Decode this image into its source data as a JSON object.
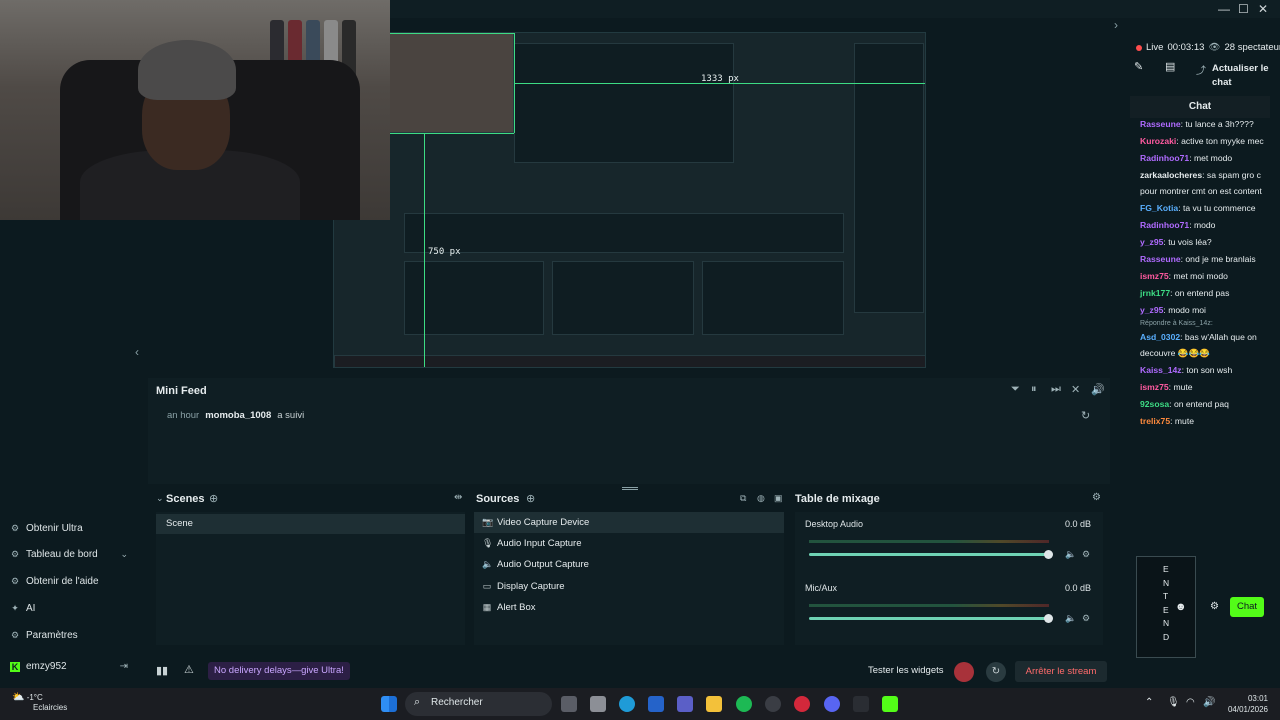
{
  "window_controls": {
    "minimize": "—",
    "maximize": "☐",
    "close": "✕"
  },
  "stream": {
    "status": "Live",
    "duration": "00:03:13",
    "viewers": "28 spectateurs",
    "refresh_chat": "Actualiser le chat"
  },
  "preview": {
    "width_label": "1333 px",
    "height_label": "750 px"
  },
  "left_nav": {
    "items": [
      {
        "label": "Obtenir Ultra",
        "icon": "ultra-icon"
      },
      {
        "label": "Tableau de bord",
        "icon": "dashboard-icon"
      },
      {
        "label": "Obtenir de l'aide",
        "icon": "help-icon"
      },
      {
        "label": "AI",
        "icon": "ai-icon"
      },
      {
        "label": "Paramètres",
        "icon": "settings-icon"
      }
    ],
    "user": "emzy952"
  },
  "mini_feed": {
    "title": "Mini Feed",
    "event": {
      "time": "an hour",
      "user": "momoba_1008",
      "action": "a suivi"
    }
  },
  "scenes": {
    "title": "Scenes",
    "items": [
      "Scene"
    ]
  },
  "sources": {
    "title": "Sources",
    "items": [
      {
        "label": "Video Capture Device",
        "icon": "camera-icon"
      },
      {
        "label": "Audio Input Capture",
        "icon": "microphone-icon"
      },
      {
        "label": "Audio Output Capture",
        "icon": "speaker-icon"
      },
      {
        "label": "Display Capture",
        "icon": "monitor-icon"
      },
      {
        "label": "Alert Box",
        "icon": "bell-icon"
      }
    ]
  },
  "mixer": {
    "title": "Table de mixage",
    "channels": [
      {
        "name": "Desktop Audio",
        "db": "0.0 dB",
        "level": 1.0
      },
      {
        "name": "Mic/Aux",
        "db": "0.0 dB",
        "level": 1.0
      }
    ]
  },
  "footer": {
    "ultra_banner": "No delivery delays—give Ultra!",
    "test_widgets": "Tester les widgets",
    "stop_stream": "Arrêter le stream"
  },
  "chat": {
    "title": "Chat",
    "send_label": "Chat",
    "input_text": "ENTEND",
    "messages": [
      {
        "user": "Rasseune",
        "text": "tu lance a 3h????",
        "color": "#b06bff"
      },
      {
        "user": "Kurozaki",
        "text": "active ton myyke mec",
        "color": "#ff5aa0"
      },
      {
        "user": "Radinhoo71",
        "text": "met modo",
        "color": "#b06bff"
      },
      {
        "user": "zarkaalocheres",
        "text": "sa spam gro c pour montrer cmt on est content",
        "color": "#e6ecee"
      },
      {
        "user": "FG_Kotia",
        "text": "ta vu tu commence",
        "color": "#5ab0ff"
      },
      {
        "user": "Radinhoo71",
        "text": "modo",
        "color": "#b06bff"
      },
      {
        "user": "y_z95",
        "text": "tu vois léa?",
        "color": "#b06bff"
      },
      {
        "user": "Rasseune",
        "text": "ond je me branlais",
        "color": "#b06bff"
      },
      {
        "user": "ismz75",
        "text": "met moi modo",
        "color": "#ff5aa0"
      },
      {
        "user": "jrnk177",
        "text": "on entend pas",
        "color": "#3ddc84"
      },
      {
        "user": "y_z95",
        "text": "modo moi",
        "color": "#b06bff"
      },
      {
        "reply": "Répondre à Kaiss_14z:",
        "user": "Asd_0302",
        "text": "bas w'Allah que on decouvre 😂😂😂",
        "color": "#5ab0ff"
      },
      {
        "user": "Kaiss_14z",
        "text": "ton son wsh",
        "color": "#b06bff"
      },
      {
        "user": "ismz75",
        "text": "mute",
        "color": "#ff5aa0"
      },
      {
        "user": "92sosa",
        "text": "on entend paq",
        "color": "#3ddc84"
      },
      {
        "user": "trelix75",
        "text": "mute",
        "color": "#ff8a3d"
      }
    ]
  },
  "taskbar": {
    "weather_temp": "-1°C",
    "weather_desc": "Eclaircies",
    "search_placeholder": "Rechercher",
    "time": "03:01",
    "date": "04/01/2026"
  },
  "colors": {
    "kick_green": "#53fc18",
    "live_red": "#ff4d4d",
    "guide_green": "#3ddc84",
    "background": "#0c1a1f"
  }
}
